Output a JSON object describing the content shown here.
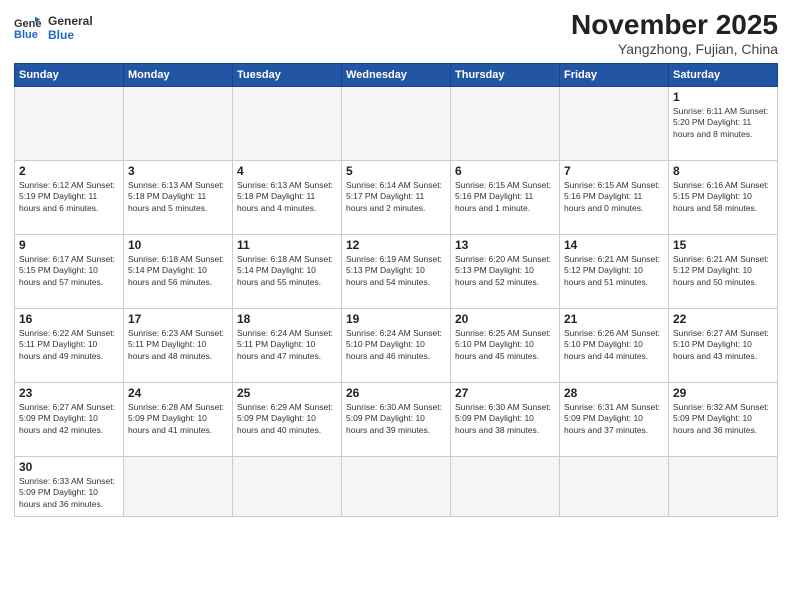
{
  "header": {
    "logo_general": "General",
    "logo_blue": "Blue",
    "month_title": "November 2025",
    "location": "Yangzhong, Fujian, China"
  },
  "weekdays": [
    "Sunday",
    "Monday",
    "Tuesday",
    "Wednesday",
    "Thursday",
    "Friday",
    "Saturday"
  ],
  "weeks": [
    [
      {
        "day": "",
        "info": ""
      },
      {
        "day": "",
        "info": ""
      },
      {
        "day": "",
        "info": ""
      },
      {
        "day": "",
        "info": ""
      },
      {
        "day": "",
        "info": ""
      },
      {
        "day": "",
        "info": ""
      },
      {
        "day": "1",
        "info": "Sunrise: 6:11 AM\nSunset: 5:20 PM\nDaylight: 11 hours\nand 8 minutes."
      }
    ],
    [
      {
        "day": "2",
        "info": "Sunrise: 6:12 AM\nSunset: 5:19 PM\nDaylight: 11 hours\nand 6 minutes."
      },
      {
        "day": "3",
        "info": "Sunrise: 6:13 AM\nSunset: 5:18 PM\nDaylight: 11 hours\nand 5 minutes."
      },
      {
        "day": "4",
        "info": "Sunrise: 6:13 AM\nSunset: 5:18 PM\nDaylight: 11 hours\nand 4 minutes."
      },
      {
        "day": "5",
        "info": "Sunrise: 6:14 AM\nSunset: 5:17 PM\nDaylight: 11 hours\nand 2 minutes."
      },
      {
        "day": "6",
        "info": "Sunrise: 6:15 AM\nSunset: 5:16 PM\nDaylight: 11 hours\nand 1 minute."
      },
      {
        "day": "7",
        "info": "Sunrise: 6:15 AM\nSunset: 5:16 PM\nDaylight: 11 hours\nand 0 minutes."
      },
      {
        "day": "8",
        "info": "Sunrise: 6:16 AM\nSunset: 5:15 PM\nDaylight: 10 hours\nand 58 minutes."
      }
    ],
    [
      {
        "day": "9",
        "info": "Sunrise: 6:17 AM\nSunset: 5:15 PM\nDaylight: 10 hours\nand 57 minutes."
      },
      {
        "day": "10",
        "info": "Sunrise: 6:18 AM\nSunset: 5:14 PM\nDaylight: 10 hours\nand 56 minutes."
      },
      {
        "day": "11",
        "info": "Sunrise: 6:18 AM\nSunset: 5:14 PM\nDaylight: 10 hours\nand 55 minutes."
      },
      {
        "day": "12",
        "info": "Sunrise: 6:19 AM\nSunset: 5:13 PM\nDaylight: 10 hours\nand 54 minutes."
      },
      {
        "day": "13",
        "info": "Sunrise: 6:20 AM\nSunset: 5:13 PM\nDaylight: 10 hours\nand 52 minutes."
      },
      {
        "day": "14",
        "info": "Sunrise: 6:21 AM\nSunset: 5:12 PM\nDaylight: 10 hours\nand 51 minutes."
      },
      {
        "day": "15",
        "info": "Sunrise: 6:21 AM\nSunset: 5:12 PM\nDaylight: 10 hours\nand 50 minutes."
      }
    ],
    [
      {
        "day": "16",
        "info": "Sunrise: 6:22 AM\nSunset: 5:11 PM\nDaylight: 10 hours\nand 49 minutes."
      },
      {
        "day": "17",
        "info": "Sunrise: 6:23 AM\nSunset: 5:11 PM\nDaylight: 10 hours\nand 48 minutes."
      },
      {
        "day": "18",
        "info": "Sunrise: 6:24 AM\nSunset: 5:11 PM\nDaylight: 10 hours\nand 47 minutes."
      },
      {
        "day": "19",
        "info": "Sunrise: 6:24 AM\nSunset: 5:10 PM\nDaylight: 10 hours\nand 46 minutes."
      },
      {
        "day": "20",
        "info": "Sunrise: 6:25 AM\nSunset: 5:10 PM\nDaylight: 10 hours\nand 45 minutes."
      },
      {
        "day": "21",
        "info": "Sunrise: 6:26 AM\nSunset: 5:10 PM\nDaylight: 10 hours\nand 44 minutes."
      },
      {
        "day": "22",
        "info": "Sunrise: 6:27 AM\nSunset: 5:10 PM\nDaylight: 10 hours\nand 43 minutes."
      }
    ],
    [
      {
        "day": "23",
        "info": "Sunrise: 6:27 AM\nSunset: 5:09 PM\nDaylight: 10 hours\nand 42 minutes."
      },
      {
        "day": "24",
        "info": "Sunrise: 6:28 AM\nSunset: 5:09 PM\nDaylight: 10 hours\nand 41 minutes."
      },
      {
        "day": "25",
        "info": "Sunrise: 6:29 AM\nSunset: 5:09 PM\nDaylight: 10 hours\nand 40 minutes."
      },
      {
        "day": "26",
        "info": "Sunrise: 6:30 AM\nSunset: 5:09 PM\nDaylight: 10 hours\nand 39 minutes."
      },
      {
        "day": "27",
        "info": "Sunrise: 6:30 AM\nSunset: 5:09 PM\nDaylight: 10 hours\nand 38 minutes."
      },
      {
        "day": "28",
        "info": "Sunrise: 6:31 AM\nSunset: 5:09 PM\nDaylight: 10 hours\nand 37 minutes."
      },
      {
        "day": "29",
        "info": "Sunrise: 6:32 AM\nSunset: 5:09 PM\nDaylight: 10 hours\nand 36 minutes."
      }
    ],
    [
      {
        "day": "30",
        "info": "Sunrise: 6:33 AM\nSunset: 5:09 PM\nDaylight: 10 hours\nand 36 minutes."
      },
      {
        "day": "",
        "info": ""
      },
      {
        "day": "",
        "info": ""
      },
      {
        "day": "",
        "info": ""
      },
      {
        "day": "",
        "info": ""
      },
      {
        "day": "",
        "info": ""
      },
      {
        "day": "",
        "info": ""
      }
    ]
  ]
}
